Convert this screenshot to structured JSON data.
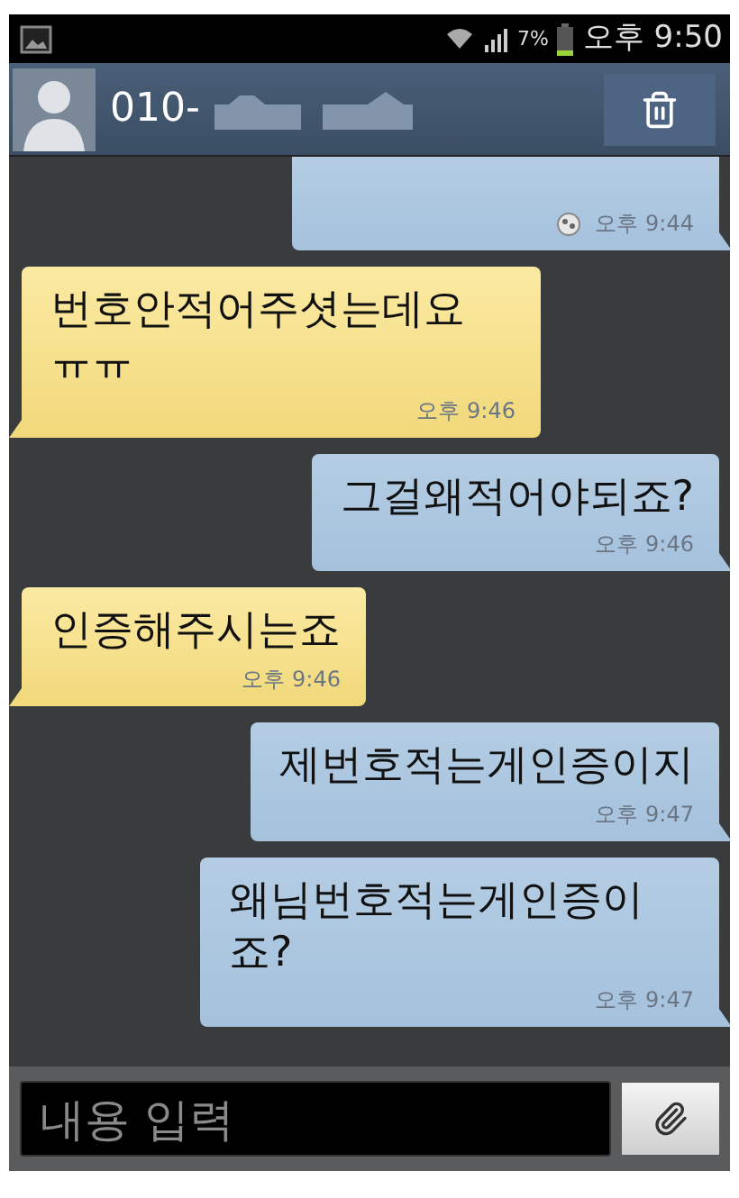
{
  "status_bar": {
    "battery": "7%",
    "time": "오후 9:50"
  },
  "header": {
    "contact": "010-"
  },
  "messages": [
    {
      "kind": "sent",
      "time": "오후 9:44",
      "pending": true
    },
    {
      "kind": "received",
      "text": "번호안적어주셧는데요 ㅠㅠ",
      "time": "오후 9:46"
    },
    {
      "kind": "sent",
      "text": "그걸왜적어야되죠?",
      "time": "오후 9:46"
    },
    {
      "kind": "received",
      "text": "인증해주시는죠",
      "time": "오후 9:46"
    },
    {
      "kind": "sent",
      "text": "제번호적는게인증이지",
      "time": "오후 9:47"
    },
    {
      "kind": "sent",
      "text": "왜님번호적는게인증이죠?",
      "time": "오후 9:47"
    }
  ],
  "composer": {
    "placeholder": "내용 입력"
  }
}
